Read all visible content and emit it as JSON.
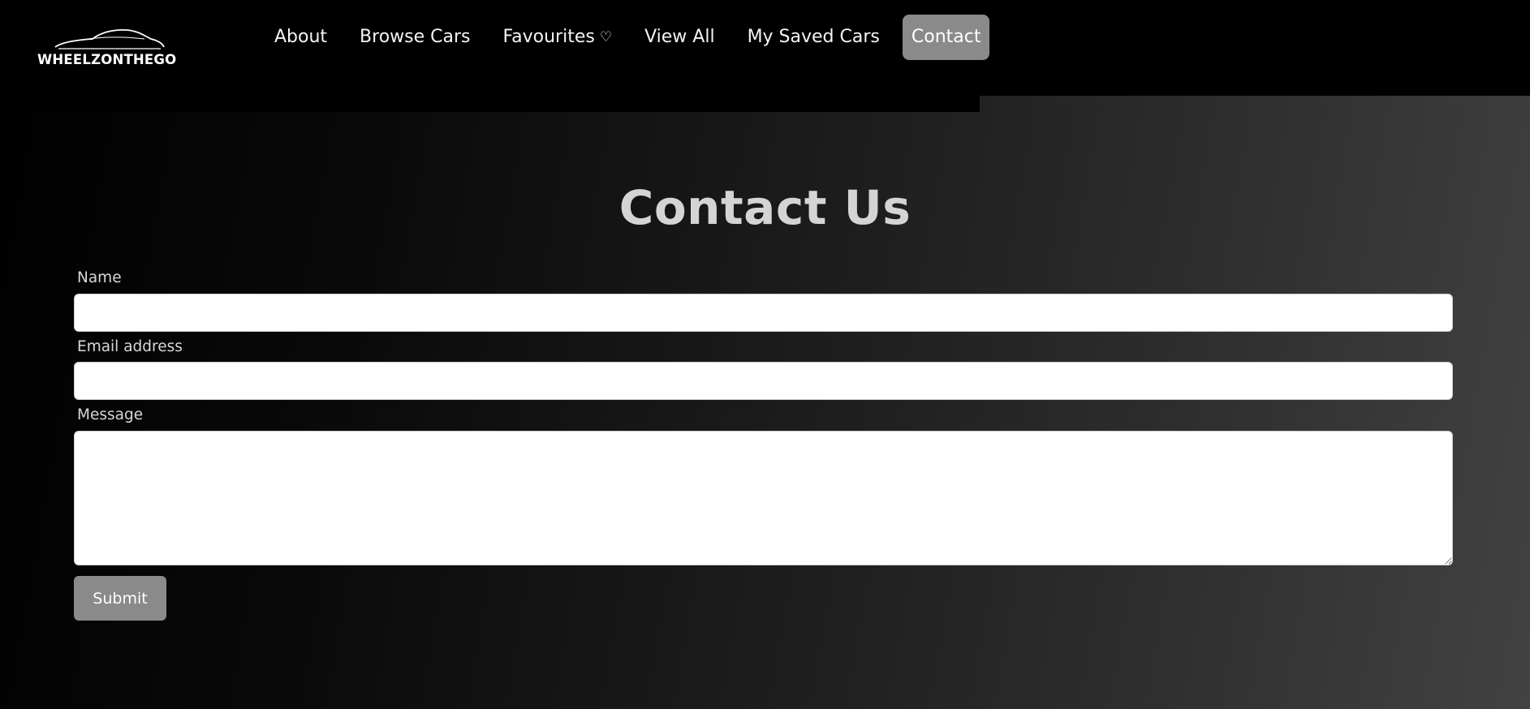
{
  "brand": {
    "name": "WHEELZONTHEGO"
  },
  "nav": {
    "items": [
      {
        "label": "About"
      },
      {
        "label": "Browse Cars"
      },
      {
        "label": "Favourites",
        "icon": "heart-icon",
        "glyph": "♡"
      },
      {
        "label": "View All"
      },
      {
        "label": "My Saved Cars"
      },
      {
        "label": "Contact",
        "active": true
      }
    ],
    "active_color": "#8a8a8a"
  },
  "page": {
    "title": "Contact Us"
  },
  "form": {
    "name_label": "Name",
    "name_value": "",
    "email_label": "Email address",
    "email_value": "",
    "message_label": "Message",
    "message_value": "",
    "submit_label": "Submit"
  },
  "colors": {
    "navbar_bg": "#000000",
    "button_bg": "#8a8a8a",
    "title_color": "#d4d4d4"
  }
}
